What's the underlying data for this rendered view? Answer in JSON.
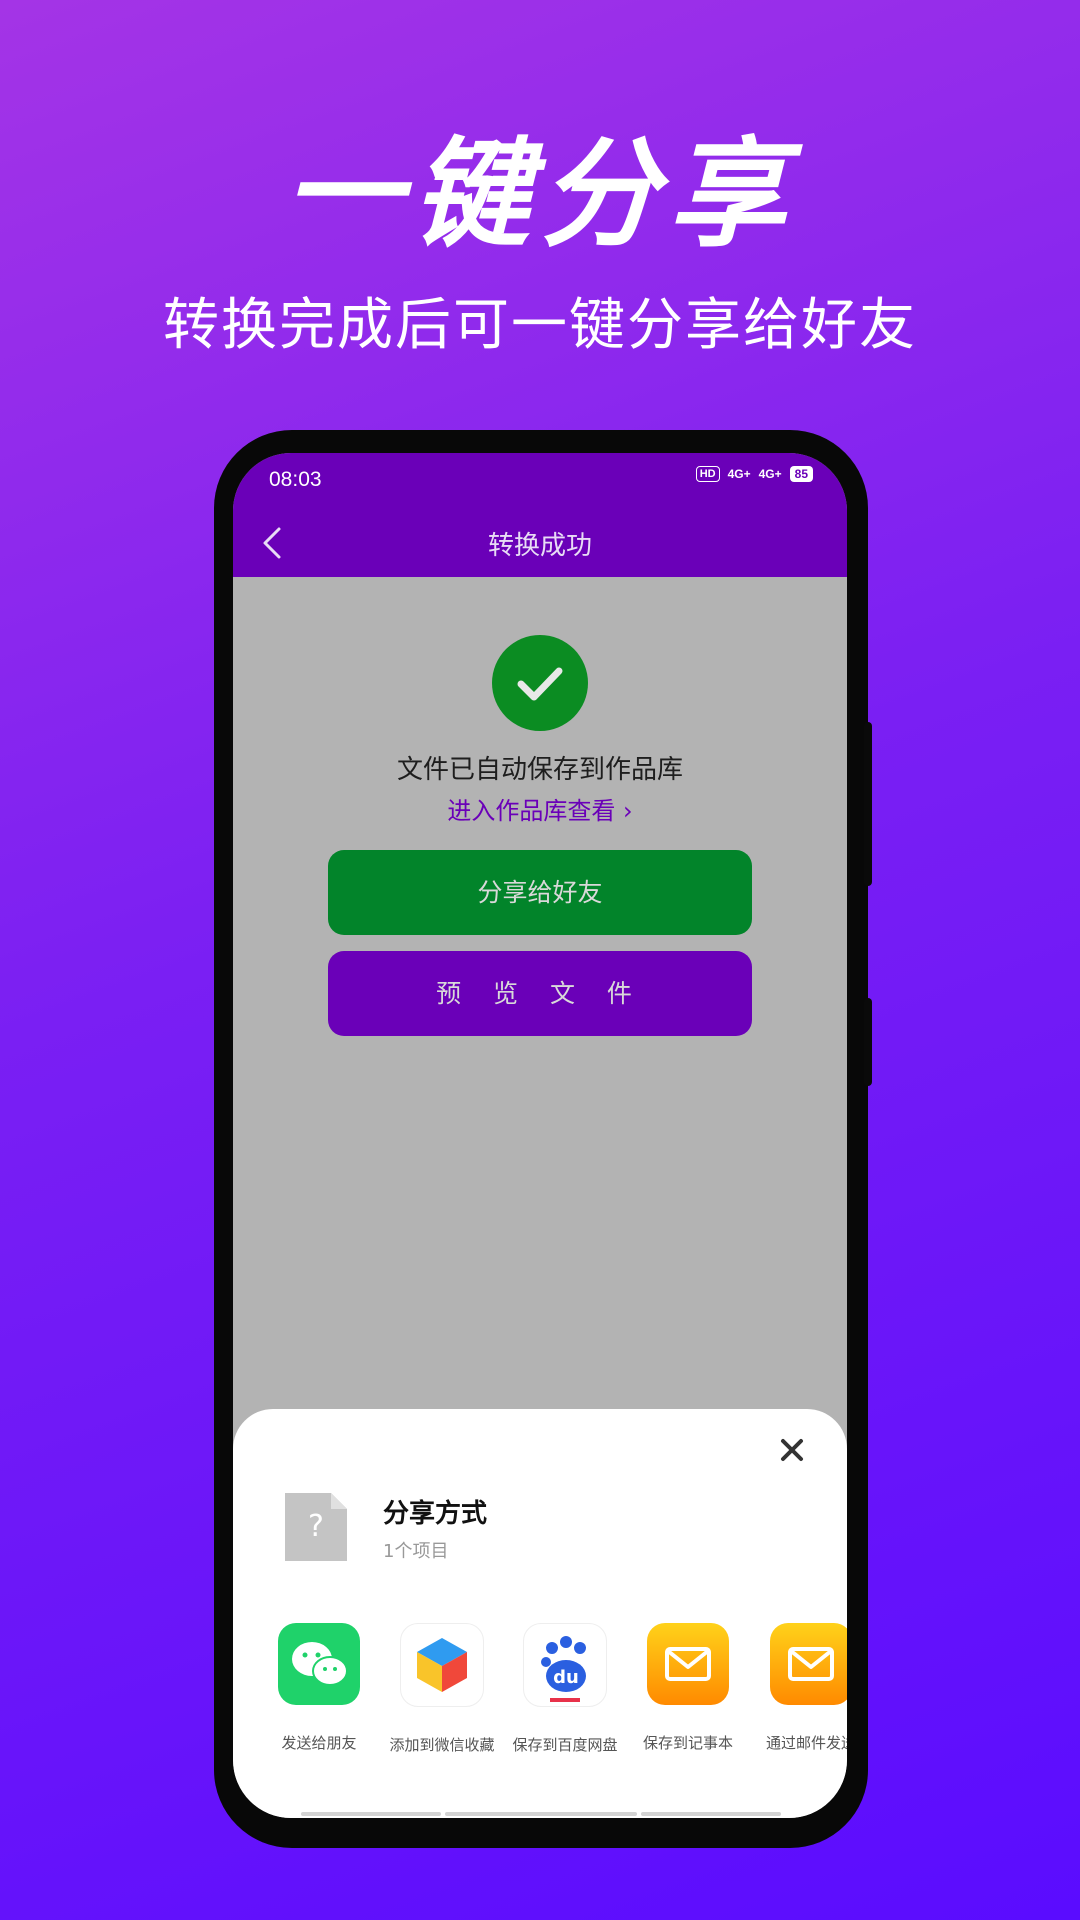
{
  "hero": {
    "title": "一键分享",
    "subtitle": "转换完成后可一键分享给好友"
  },
  "status_bar": {
    "time": "08:03",
    "hd": "HD",
    "network_1": "4G+",
    "network_2": "4G+",
    "battery": "85"
  },
  "nav": {
    "title": "转换成功"
  },
  "content": {
    "saved_message": "文件已自动保存到作品库",
    "gallery_link": "进入作品库查看 ›",
    "share_button": "分享给好友",
    "preview_button": "预 览 文 件"
  },
  "share_sheet": {
    "title": "分享方式",
    "count": "1个项目",
    "file_icon_glyph": "?",
    "apps": [
      {
        "label": "发送给朋友",
        "icon": "wechat-icon"
      },
      {
        "label": "添加到微信收藏",
        "icon": "wechat-favorites-icon"
      },
      {
        "label": "保存到百度网盘",
        "icon": "baidu-netdisk-icon"
      },
      {
        "label": "保存到记事本",
        "icon": "notes-mail-icon"
      },
      {
        "label": "通过邮件发送",
        "icon": "mail-icon"
      }
    ]
  },
  "colors": {
    "primary_purple": "#6a00b8",
    "success_green": "#02842a",
    "background_gradient_start": "#a434e6",
    "background_gradient_end": "#5a0cff"
  }
}
